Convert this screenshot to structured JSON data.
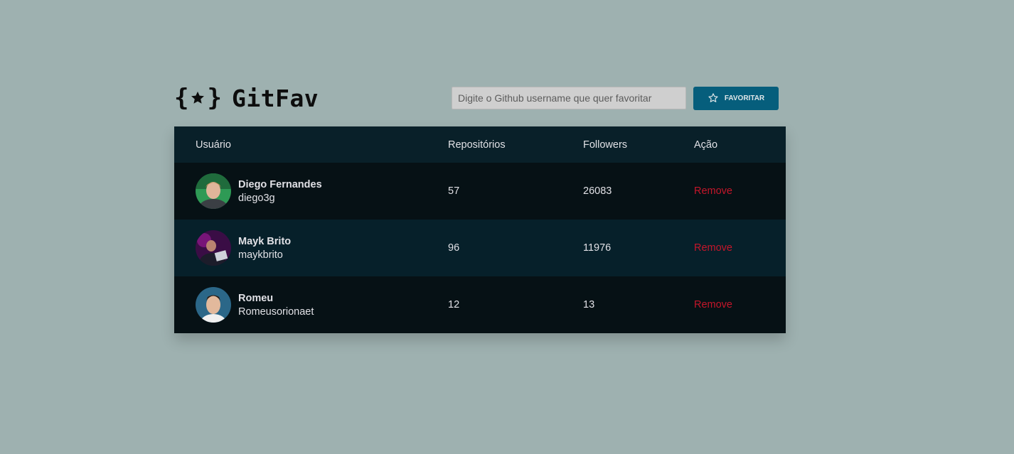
{
  "header": {
    "logo_text": "GitFav",
    "search_placeholder": "Digite o Github username que quer favoritar",
    "favorite_button": "FAVORITAR"
  },
  "table": {
    "columns": [
      "Usuário",
      "Repositórios",
      "Followers",
      "Ação"
    ],
    "rows": [
      {
        "name": "Diego Fernandes",
        "login": "diego3g",
        "repos": "57",
        "followers": "26083",
        "action": "Remove"
      },
      {
        "name": "Mayk Brito",
        "login": "maykbrito",
        "repos": "96",
        "followers": "11976",
        "action": "Remove"
      },
      {
        "name": "Romeu",
        "login": "Romeusorionaet",
        "repos": "12",
        "followers": "13",
        "action": "Remove"
      }
    ]
  },
  "colors": {
    "background": "#9eb1b0",
    "header_row": "#092029",
    "row_dark": "#061115",
    "row_alt": "#06202a",
    "button": "#065e7c",
    "remove": "#c4162a"
  }
}
